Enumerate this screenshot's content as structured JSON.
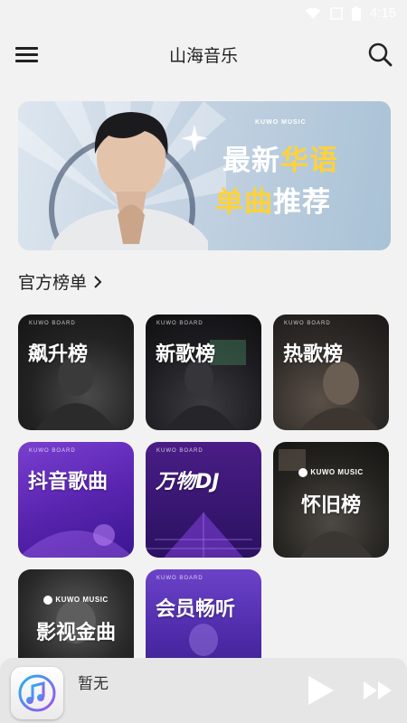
{
  "status_bar": {
    "time": "4:15"
  },
  "header": {
    "title": "山海音乐"
  },
  "banner": {
    "brand": "KUWO MUSIC",
    "line1_a": "最新",
    "line1_b": "华语",
    "line2_a": "单曲",
    "line2_b": "推荐"
  },
  "section": {
    "title": "官方榜单"
  },
  "charts": [
    {
      "label": "飙升榜",
      "board": "KUWO BOARD"
    },
    {
      "label": "新歌榜",
      "board": "KUWO BOARD"
    },
    {
      "label": "热歌榜",
      "board": "KUWO BOARD"
    },
    {
      "label": "抖音歌曲",
      "board": "KUWO BOARD"
    },
    {
      "label": "万物DJ",
      "board": "KUWO BOARD"
    },
    {
      "label": "怀旧榜",
      "board": "KUWO MUSIC"
    },
    {
      "label": "影视金曲",
      "board": "KUWO MUSIC"
    },
    {
      "label": "会员畅听",
      "board": "KUWO BOARD"
    }
  ],
  "player": {
    "title": "暂无"
  },
  "colors": {
    "accent_yellow": "#ffd23a",
    "purple": "#6b42c8"
  },
  "icons": {
    "menu": "menu-icon",
    "search": "search-icon",
    "chevron": "chevron-right-icon",
    "play": "play-icon",
    "next": "next-icon",
    "music_app": "music-note-icon"
  }
}
